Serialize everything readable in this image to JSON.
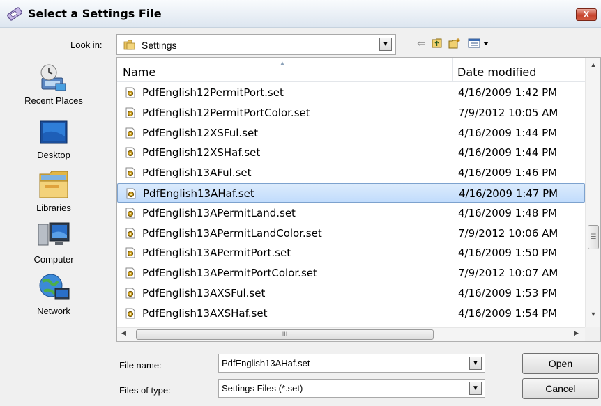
{
  "window": {
    "title": "Select a Settings File",
    "close_glyph": "X"
  },
  "toolbar": {
    "look_in_label": "Look in:",
    "look_in_value": "Settings",
    "back_icon": "back-arrow-icon",
    "up_icon": "up-folder-icon",
    "new_folder_icon": "new-folder-icon",
    "view_menu_icon": "view-menu-icon"
  },
  "places": [
    {
      "label": "Recent Places",
      "icon": "recent-places-icon"
    },
    {
      "label": "Desktop",
      "icon": "desktop-icon"
    },
    {
      "label": "Libraries",
      "icon": "libraries-icon"
    },
    {
      "label": "Computer",
      "icon": "computer-icon"
    },
    {
      "label": "Network",
      "icon": "network-icon"
    }
  ],
  "columns": {
    "name": "Name",
    "date_modified": "Date modified"
  },
  "files": [
    {
      "name": "PdfEnglish12PermitPort.set",
      "date": "4/16/2009 1:42 PM"
    },
    {
      "name": "PdfEnglish12PermitPortColor.set",
      "date": "7/9/2012 10:05 AM"
    },
    {
      "name": "PdfEnglish12XSFul.set",
      "date": "4/16/2009 1:44 PM"
    },
    {
      "name": "PdfEnglish12XSHaf.set",
      "date": "4/16/2009 1:44 PM"
    },
    {
      "name": "PdfEnglish13AFul.set",
      "date": "4/16/2009 1:46 PM"
    },
    {
      "name": "PdfEnglish13AHaf.set",
      "date": "4/16/2009 1:47 PM",
      "selected": true
    },
    {
      "name": "PdfEnglish13APermitLand.set",
      "date": "4/16/2009 1:48 PM"
    },
    {
      "name": "PdfEnglish13APermitLandColor.set",
      "date": "7/9/2012 10:06 AM"
    },
    {
      "name": "PdfEnglish13APermitPort.set",
      "date": "4/16/2009 1:50 PM"
    },
    {
      "name": "PdfEnglish13APermitPortColor.set",
      "date": "7/9/2012 10:07 AM"
    },
    {
      "name": "PdfEnglish13AXSFul.set",
      "date": "4/16/2009 1:53 PM"
    },
    {
      "name": "PdfEnglish13AXSHaf.set",
      "date": "4/16/2009 1:54 PM"
    }
  ],
  "scrollbar": {
    "hthumb_grip": "III",
    "vthumb_grip": "☰"
  },
  "form": {
    "file_name_label": "File name:",
    "file_name_value": "PdfEnglish13AHaf.set",
    "files_of_type_label": "Files of type:",
    "files_of_type_value": "Settings Files (*.set)"
  },
  "buttons": {
    "open": "Open",
    "cancel": "Cancel"
  },
  "colors": {
    "selection": "#c9e0fb",
    "selection_border": "#7da2ce",
    "close_button": "#c7432d"
  }
}
